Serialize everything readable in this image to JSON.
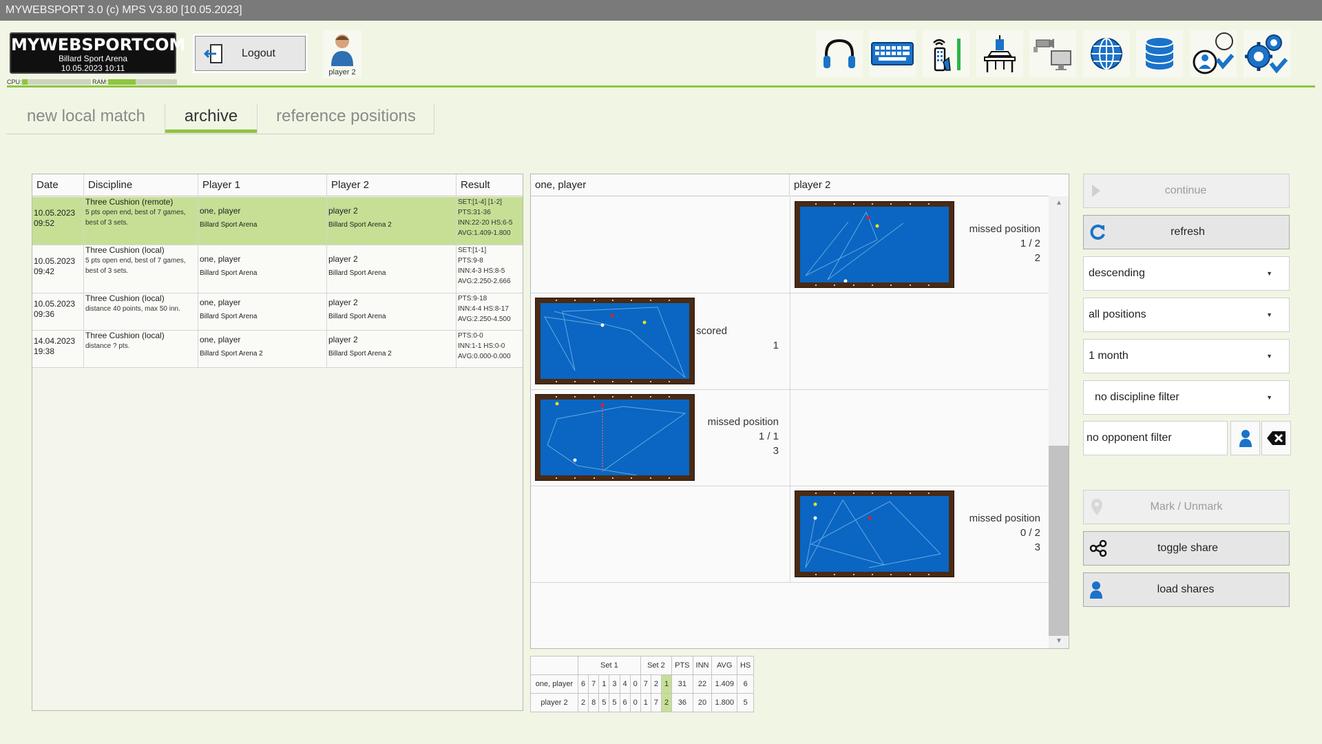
{
  "window": {
    "title": "MYWEBSPORT 3.0  (c) MPS V3.80 [10.05.2023]"
  },
  "logo": {
    "title": "MYWEBSPORTCOM",
    "venue": "Billard Sport Arena",
    "datetime": "10.05.2023  10:11"
  },
  "meters": {
    "cpu_label": "CPU:",
    "ram_label": "RAM:",
    "cpu_level": 0.08,
    "ram_level": 0.4
  },
  "header": {
    "logout_label": "Logout",
    "user_name": "player 2"
  },
  "toolbar_icons": [
    "headphones-icon",
    "keyboard-icon",
    "remote-signal-icon",
    "table-lamp-icon",
    "camera-monitor-icon",
    "globe-icon",
    "database-icon",
    "user-check-icon",
    "settings-check-icon"
  ],
  "tabs": [
    {
      "label": "new local match",
      "active": false
    },
    {
      "label": "archive",
      "active": true
    },
    {
      "label": "reference positions",
      "active": false
    }
  ],
  "matches": {
    "headers": [
      "Date",
      "Discipline",
      "Player 1",
      "Player 2",
      "Result"
    ],
    "rows": [
      {
        "date": "10.05.2023",
        "time": "09:52",
        "discipline": "Three Cushion (remote)",
        "disc_details": "5 pts open end, best of 7 games,",
        "disc_details2": "best of 3 sets.",
        "p1_name": "one, player",
        "p1_club": "Billard Sport Arena",
        "p2_name": "player 2",
        "p2_club": "Billard Sport Arena 2",
        "result": [
          "SET:[1-4] [1-2]",
          "PTS:31-36",
          "INN:22-20   HS:6-5",
          "AVG:1.409-1.800"
        ],
        "selected": true
      },
      {
        "date": "10.05.2023",
        "time": "09:42",
        "discipline": "Three Cushion (local)",
        "disc_details": "5 pts open end, best of 7 games,",
        "disc_details2": "best of 3 sets.",
        "p1_name": "one, player",
        "p1_club": "Billard Sport Arena",
        "p2_name": "player 2",
        "p2_club": "Billard Sport Arena",
        "result": [
          "SET:[1-1]",
          "PTS:9-8",
          "INN:4-3    HS:8-5",
          "AVG:2.250-2.666"
        ],
        "selected": false
      },
      {
        "date": "10.05.2023",
        "time": "09:36",
        "discipline": "Three Cushion (local)",
        "disc_details": "distance 40 points, max 50 inn.",
        "disc_details2": "",
        "p1_name": "one, player",
        "p1_club": "Billard Sport Arena",
        "p2_name": "player 2",
        "p2_club": "Billard Sport Arena",
        "result": [
          "PTS:9-18",
          "INN:4-4    HS:8-17",
          "AVG:2.250-4.500"
        ],
        "selected": false
      },
      {
        "date": "14.04.2023",
        "time": "19:38",
        "discipline": "Three Cushion (local)",
        "disc_details": "distance ? pts.",
        "disc_details2": "",
        "p1_name": "one, player",
        "p1_club": "Billard Sport Arena 2",
        "p2_name": "player 2",
        "p2_club": "Billard Sport Arena 2",
        "result": [
          "PTS:0-0",
          "INN:1-1    HS:0-0",
          "AVG:0.000-0.000"
        ],
        "selected": false
      }
    ]
  },
  "positions": {
    "headers": [
      "one, player",
      "player 2"
    ],
    "rows": [
      {
        "side": "right",
        "status": "missed position",
        "score": "1 / 2",
        "number": "2"
      },
      {
        "side": "left",
        "status": "scored",
        "score": "1",
        "number": ""
      },
      {
        "side": "left",
        "status": "missed position",
        "score": "1 / 1",
        "number": "3"
      },
      {
        "side": "right",
        "status": "missed position",
        "score": "0 / 2",
        "number": "3"
      }
    ]
  },
  "score": {
    "set1_label": "Set 1",
    "set2_label": "Set 2",
    "col_pts": "PTS",
    "col_inn": "INN",
    "col_avg": "AVG",
    "col_hs": "HS",
    "rows": [
      {
        "name": "one, player",
        "set1": [
          "6",
          "7",
          "1",
          "3",
          "4",
          "0"
        ],
        "set2": [
          "7",
          "2",
          "1"
        ],
        "pts": "31",
        "inn": "22",
        "avg": "1.409",
        "hs": "6"
      },
      {
        "name": "player 2",
        "set1": [
          "2",
          "8",
          "5",
          "5",
          "6",
          "0"
        ],
        "set2": [
          "1",
          "7",
          "2"
        ],
        "pts": "36",
        "inn": "20",
        "avg": "1.800",
        "hs": "5"
      }
    ]
  },
  "controls": {
    "continue_label": "continue",
    "refresh_label": "refresh",
    "sort_value": "descending",
    "positions_filter": "all positions",
    "period_filter": "1 month",
    "discipline_filter": "no discipline filter",
    "opponent_filter": "no opponent filter",
    "mark_label": "Mark / Unmark",
    "share_label": "toggle share",
    "load_label": "load shares"
  },
  "colors": {
    "accent": "#8dc63f",
    "felt": "#0a66c2",
    "rail": "#4a2a14",
    "icon_blue": "#1a73c9"
  }
}
